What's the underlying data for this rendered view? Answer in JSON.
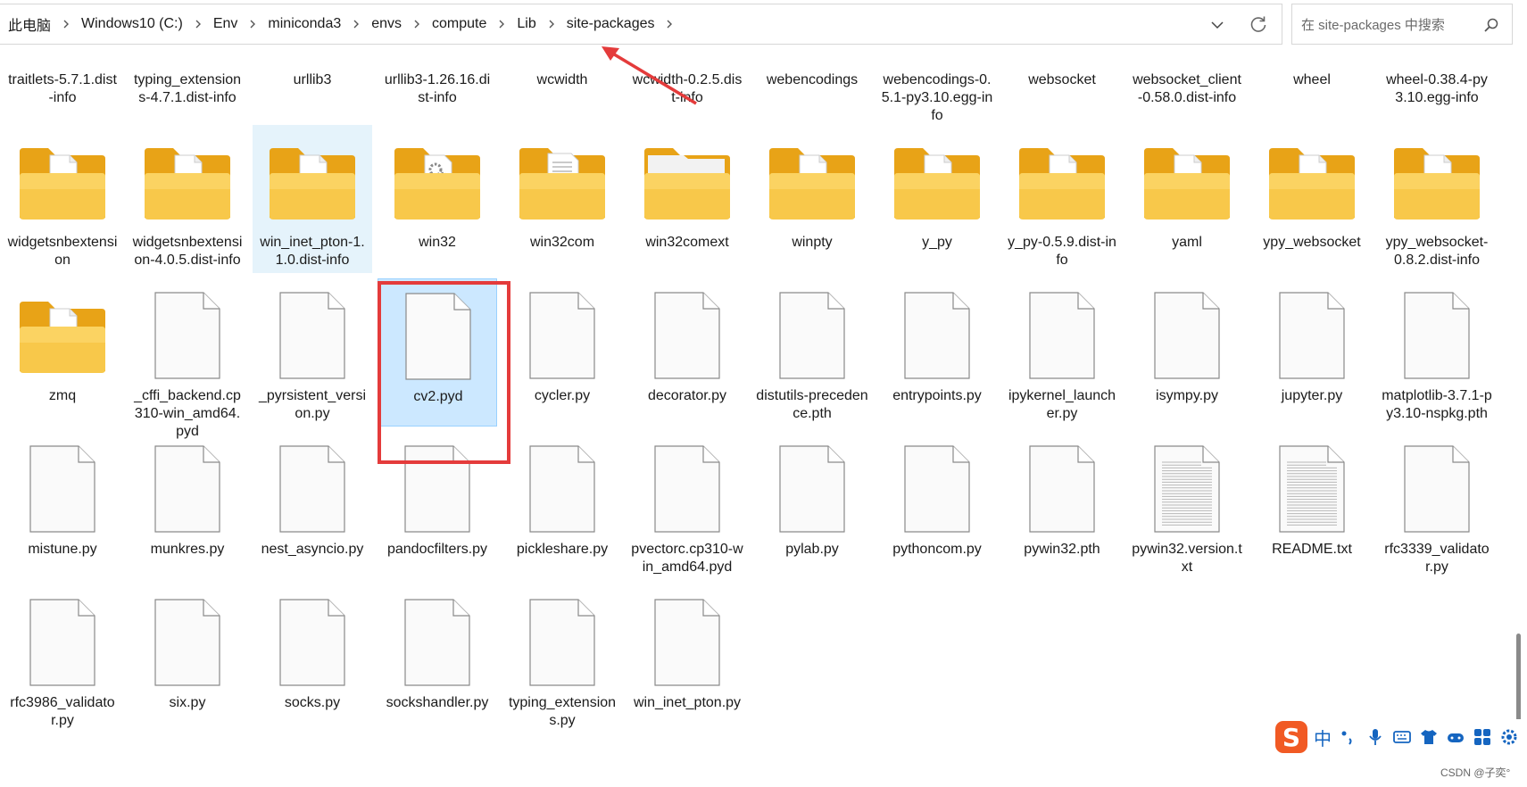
{
  "breadcrumb": [
    "此电脑",
    "Windows10 (C:)",
    "Env",
    "miniconda3",
    "envs",
    "compute",
    "Lib",
    "site-packages"
  ],
  "search": {
    "placeholder": "在 site-packages 中搜索"
  },
  "rows": [
    [
      {
        "label": "traitlets-5.7.1.dist-info",
        "type": "none"
      },
      {
        "label": "typing_extensions-4.7.1.dist-info",
        "type": "none"
      },
      {
        "label": "urllib3",
        "type": "none"
      },
      {
        "label": "urllib3-1.26.16.dist-info",
        "type": "none"
      },
      {
        "label": "wcwidth",
        "type": "none"
      },
      {
        "label": "wcwidth-0.2.5.dist-info",
        "type": "none"
      },
      {
        "label": "webencodings",
        "type": "none"
      },
      {
        "label": "webencodings-0.5.1-py3.10.egg-info",
        "type": "none"
      },
      {
        "label": "websocket",
        "type": "none"
      },
      {
        "label": "websocket_client-0.58.0.dist-info",
        "type": "none"
      },
      {
        "label": "wheel",
        "type": "none"
      },
      {
        "label": "wheel-0.38.4-py3.10.egg-info",
        "type": "none"
      }
    ],
    [
      {
        "label": "widgetsnbextension",
        "type": "folder-doc"
      },
      {
        "label": "widgetsnbextension-4.0.5.dist-info",
        "type": "folder-doc"
      },
      {
        "label": "win_inet_pton-1.1.0.dist-info",
        "type": "folder-doc",
        "state": "hover"
      },
      {
        "label": "win32",
        "type": "folder-gear"
      },
      {
        "label": "win32com",
        "type": "folder-text"
      },
      {
        "label": "win32comext",
        "type": "folder-plain"
      },
      {
        "label": "winpty",
        "type": "folder-doc"
      },
      {
        "label": "y_py",
        "type": "folder-doc"
      },
      {
        "label": "y_py-0.5.9.dist-info",
        "type": "folder-doc"
      },
      {
        "label": "yaml",
        "type": "folder-doc"
      },
      {
        "label": "ypy_websocket",
        "type": "folder-doc"
      },
      {
        "label": "ypy_websocket-0.8.2.dist-info",
        "type": "folder-doc"
      }
    ],
    [
      {
        "label": "zmq",
        "type": "folder-doc"
      },
      {
        "label": "_cffi_backend.cp310-win_amd64.pyd",
        "type": "file"
      },
      {
        "label": "_pyrsistent_version.py",
        "type": "file"
      },
      {
        "label": "cv2.pyd",
        "type": "file",
        "state": "selected"
      },
      {
        "label": "cycler.py",
        "type": "file"
      },
      {
        "label": "decorator.py",
        "type": "file"
      },
      {
        "label": "distutils-precedence.pth",
        "type": "file"
      },
      {
        "label": "entrypoints.py",
        "type": "file"
      },
      {
        "label": "ipykernel_launcher.py",
        "type": "file"
      },
      {
        "label": "isympy.py",
        "type": "file"
      },
      {
        "label": "jupyter.py",
        "type": "file"
      },
      {
        "label": "matplotlib-3.7.1-py3.10-nspkg.pth",
        "type": "file"
      }
    ],
    [
      {
        "label": "mistune.py",
        "type": "file"
      },
      {
        "label": "munkres.py",
        "type": "file"
      },
      {
        "label": "nest_asyncio.py",
        "type": "file"
      },
      {
        "label": "pandocfilters.py",
        "type": "file"
      },
      {
        "label": "pickleshare.py",
        "type": "file"
      },
      {
        "label": "pvectorc.cp310-win_amd64.pyd",
        "type": "file"
      },
      {
        "label": "pylab.py",
        "type": "file"
      },
      {
        "label": "pythoncom.py",
        "type": "file"
      },
      {
        "label": "pywin32.pth",
        "type": "file"
      },
      {
        "label": "pywin32.version.txt",
        "type": "file-text"
      },
      {
        "label": "README.txt",
        "type": "file-text"
      },
      {
        "label": "rfc3339_validator.py",
        "type": "file"
      }
    ],
    [
      {
        "label": "rfc3986_validator.py",
        "type": "file"
      },
      {
        "label": "six.py",
        "type": "file"
      },
      {
        "label": "socks.py",
        "type": "file"
      },
      {
        "label": "sockshandler.py",
        "type": "file"
      },
      {
        "label": "typing_extensions.py",
        "type": "file"
      },
      {
        "label": "win_inet_pton.py",
        "type": "file"
      }
    ]
  ],
  "ime": {
    "text": "中"
  },
  "watermark": "CSDN @子奕°",
  "colors": {
    "folder": "#f5c342",
    "folderBack": "#e8a317",
    "selection": "#cce8ff",
    "annotation": "#e43b3b"
  }
}
